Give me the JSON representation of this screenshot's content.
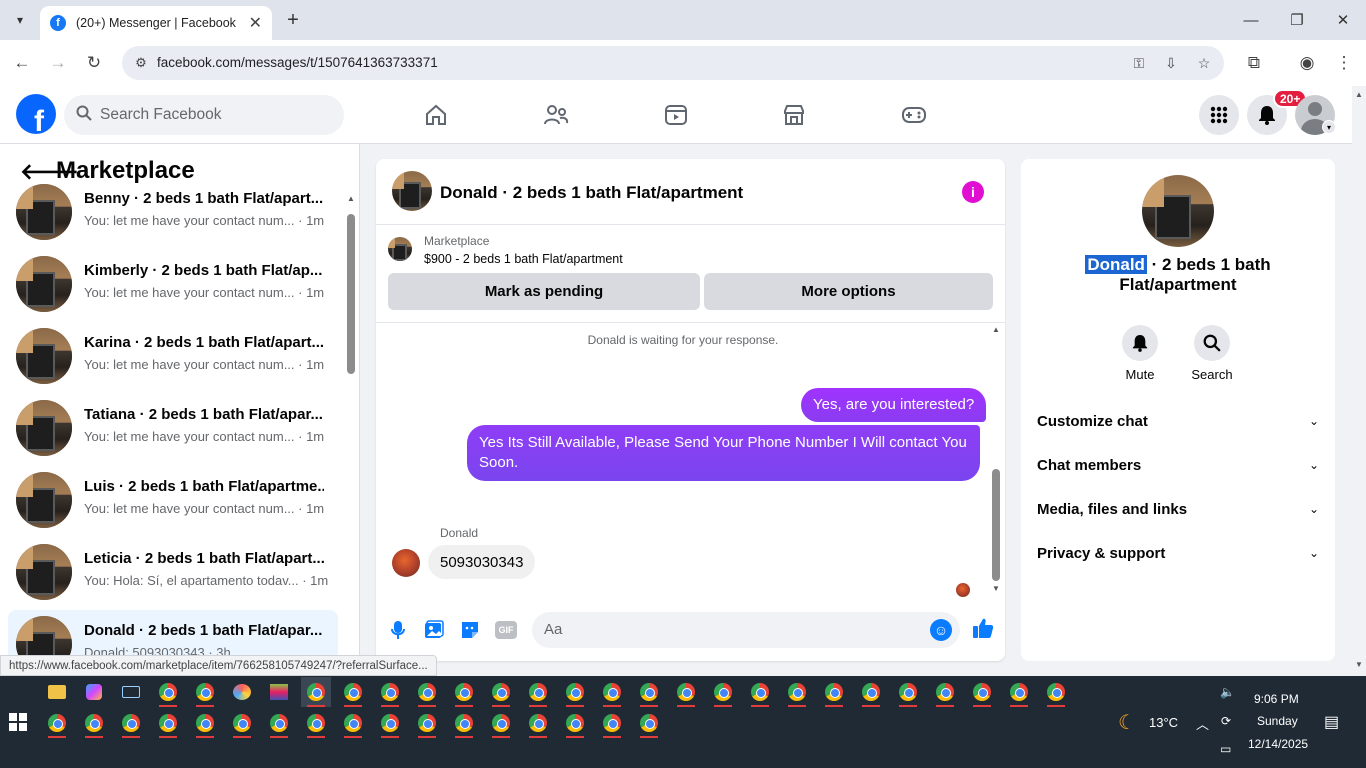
{
  "browser": {
    "tab_title": "(20+) Messenger | Facebook",
    "tab_favicon": "f",
    "url": "facebook.com/messages/t/1507641363733371",
    "status_url": "https://www.facebook.com/marketplace/item/766258105749247/?referralSurface..."
  },
  "fb": {
    "logo": "f",
    "search_placeholder": "Search Facebook",
    "notif_badge": "20+"
  },
  "left": {
    "title": "Marketplace",
    "conversations": [
      {
        "name": "Benny · 2 beds 1 bath Flat/apart...",
        "snippet": "You: let me have your contact num... · 1m"
      },
      {
        "name": "Kimberly · 2 beds 1 bath Flat/ap...",
        "snippet": "You: let me have your contact num... · 1m"
      },
      {
        "name": "Karina · 2 beds 1 bath Flat/apart...",
        "snippet": "You: let me have your contact num... · 1m"
      },
      {
        "name": "Tatiana · 2 beds 1 bath Flat/apar...",
        "snippet": "You: let me have your contact num... · 1m"
      },
      {
        "name": "Luis · 2 beds 1 bath Flat/apartme...",
        "snippet": "You: let me have your contact num... · 1m"
      },
      {
        "name": "Leticia · 2 beds 1 bath Flat/apart...",
        "snippet": "You: Hola: Sí, el apartamento todav... · 1m"
      },
      {
        "name": "Donald · 2 beds 1 bath Flat/apar...",
        "snippet": "Donald: 5093030343 · 3h"
      }
    ]
  },
  "chat": {
    "header_name": "Donald · 2 beds 1 bath Flat/apartment",
    "info_glyph": "i",
    "marketplace_label": "Marketplace",
    "listing": "$900 - 2 beds 1 bath Flat/apartment",
    "btn_pending": "Mark as pending",
    "btn_more": "More options",
    "waiting_text": "Donald is waiting for your response.",
    "out_msg_1": "Yes, are you interested?",
    "out_msg_2": "Yes Its Still Available, Please Send Your Phone Number I Will contact You Soon.",
    "in_sender": "Donald",
    "in_msg": "5093030343",
    "composer_placeholder": "Aa",
    "gif_label": "GIF"
  },
  "right": {
    "name_selected": "Donald",
    "name_rest": " · 2 beds 1 bath",
    "name_line2": "Flat/apartment",
    "mute_label": "Mute",
    "search_label": "Search",
    "rows": [
      "Customize chat",
      "Chat members",
      "Media, files and links",
      "Privacy & support"
    ]
  },
  "taskbar": {
    "weather": "13°C",
    "time": "9:06 PM",
    "day": "Sunday",
    "date": "12/14/2025"
  },
  "colors": {
    "fb_blue": "#0866ff",
    "messenger_purple": "#a033ff",
    "notif_red": "#e41e3f",
    "info_magenta": "#e10fd2"
  }
}
